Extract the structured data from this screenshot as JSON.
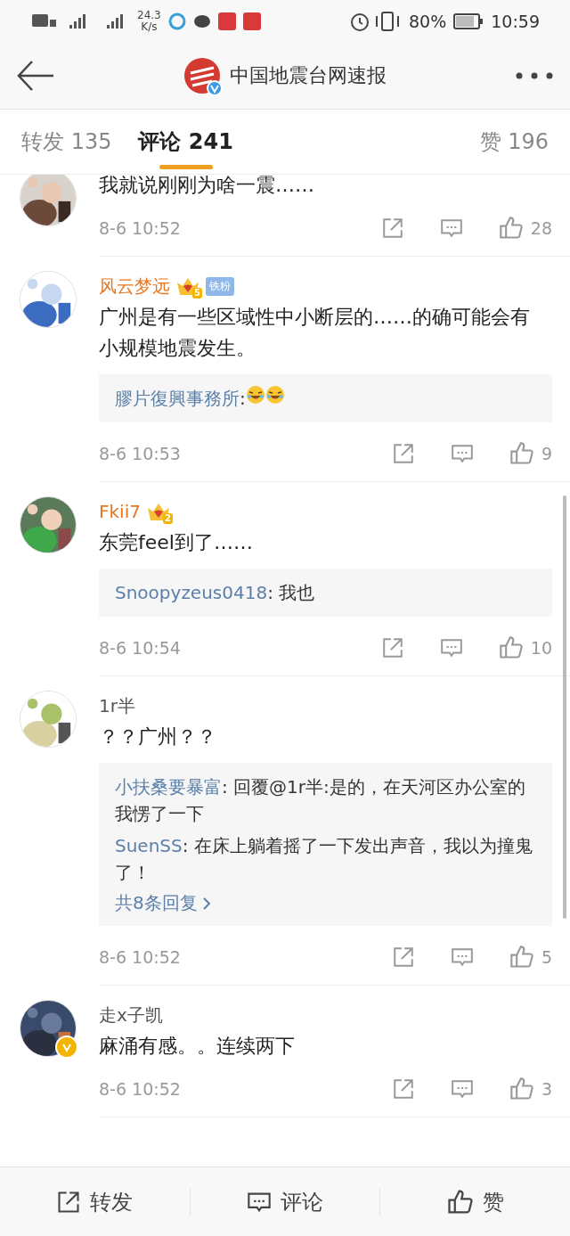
{
  "status_bar": {
    "speed": "24.3",
    "speed_unit": "K/s",
    "battery": "80%",
    "time": "10:59"
  },
  "header": {
    "title": "中国地震台网速报",
    "verified": true
  },
  "tabs": [
    {
      "label": "转发",
      "count": "135",
      "selected": false
    },
    {
      "label": "评论",
      "count": "241",
      "selected": true
    },
    {
      "label": "赞",
      "count": "196",
      "selected": false
    }
  ],
  "comments": [
    {
      "text": "我就说刚刚为啥一震……",
      "time": "8-6 10:52",
      "likes": "28"
    },
    {
      "name": "风云梦远",
      "vip": true,
      "crown_level": "5",
      "fan_badge": "铁粉",
      "text": "广州是有一些区域性中小断层的……的确可能会有小规模地震发生。",
      "replies": [
        {
          "author": "膠片復興事務所",
          "text": ":",
          "emojis": [
            {
              "kind": "laugh-cry"
            },
            {
              "kind": "laugh-cry"
            }
          ]
        }
      ],
      "time": "8-6 10:53",
      "likes": "9"
    },
    {
      "name": "Fkii7",
      "vip": true,
      "crown_level": "2",
      "text": "东莞feel到了……",
      "replies": [
        {
          "author": "Snoopyzeus0418",
          "text": ": 我也"
        }
      ],
      "time": "8-6 10:54",
      "likes": "10"
    },
    {
      "name": "1r半",
      "vip": false,
      "text": "？？广州？？",
      "replies": [
        {
          "author": "小扶桑要暴富",
          "text": ": 回覆@1r半:是的，在天河区办公室的我愣了一下"
        },
        {
          "author": "SuenSS",
          "text": ": 在床上躺着摇了一下发出声音，我以为撞鬼了！"
        }
      ],
      "more": "共8条回复",
      "time": "8-6 10:52",
      "likes": "5"
    },
    {
      "name": "走x子凯",
      "vip": false,
      "verified": true,
      "text": "麻涌有感。。连续两下",
      "time": "8-6 10:52",
      "likes": "3"
    }
  ],
  "bottom_bar": [
    {
      "kind": "repost",
      "label": "转发"
    },
    {
      "kind": "comment",
      "label": "评论"
    },
    {
      "kind": "like",
      "label": "赞"
    }
  ]
}
